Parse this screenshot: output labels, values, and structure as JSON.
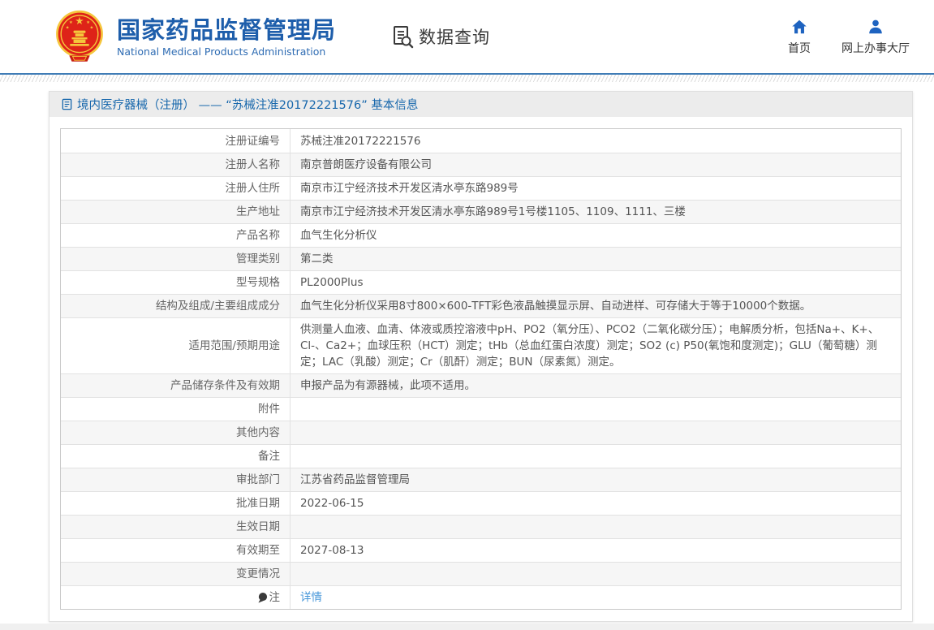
{
  "header": {
    "brand": {
      "title": "国家药品监督管理局",
      "subtitle": "National Medical Products Administration"
    },
    "data_query_label": "数据查询",
    "nav": [
      {
        "icon": "home-icon",
        "label": "首页"
      },
      {
        "icon": "user-icon",
        "label": "网上办事大厅"
      }
    ]
  },
  "page_title": "境内医疗器械（注册） —— “苏械注准20172221576” 基本信息",
  "table": {
    "rows": [
      {
        "label": "注册证编号",
        "value": "苏械注准20172221576"
      },
      {
        "label": "注册人名称",
        "value": "南京普朗医疗设备有限公司"
      },
      {
        "label": "注册人住所",
        "value": "南京市江宁经济技术开发区清水亭东路989号"
      },
      {
        "label": "生产地址",
        "value": "南京市江宁经济技术开发区清水亭东路989号1号楼1105、1109、1111、三楼"
      },
      {
        "label": "产品名称",
        "value": "血气生化分析仪"
      },
      {
        "label": "管理类别",
        "value": "第二类"
      },
      {
        "label": "型号规格",
        "value": "PL2000Plus"
      },
      {
        "label": "结构及组成/主要组成成分",
        "value": "血气生化分析仪采用8寸800×600-TFT彩色液晶触摸显示屏、自动进样、可存储大于等于10000个数据。"
      },
      {
        "label": "适用范围/预期用途",
        "value": "供测量人血液、血清、体液或质控溶液中pH、PO2（氧分压）、PCO2（二氧化碳分压）；电解质分析，包括Na+、K+、Cl-、Ca2+；血球压积（HCT）测定；tHb（总血红蛋白浓度）测定；SO2 (c) P50(氧饱和度测定)；GLU（葡萄糖）测定；LAC（乳酸）测定；Cr（肌酐）测定；BUN（尿素氮）测定。"
      },
      {
        "label": "产品储存条件及有效期",
        "value": "申报产品为有源器械，此项不适用。"
      },
      {
        "label": "附件",
        "value": ""
      },
      {
        "label": "其他内容",
        "value": ""
      },
      {
        "label": "备注",
        "value": ""
      },
      {
        "label": "审批部门",
        "value": "江苏省药品监督管理局"
      },
      {
        "label": "批准日期",
        "value": "2022-06-15"
      },
      {
        "label": "生效日期",
        "value": ""
      },
      {
        "label": "有效期至",
        "value": "2027-08-13"
      },
      {
        "label": "变更情况",
        "value": ""
      },
      {
        "label": "注",
        "value": "详情",
        "value_type": "link",
        "label_icon": "note-balloon-icon"
      }
    ]
  },
  "colors": {
    "brand_blue": "#1e5eab",
    "nav_icon_blue": "#1e63c0",
    "panel_title_blue": "#1767ac",
    "link_blue": "#4596d9",
    "emblem_red": "#de2318",
    "emblem_gold": "#f5c63c",
    "stripe_gray": "#f6f6f6"
  }
}
